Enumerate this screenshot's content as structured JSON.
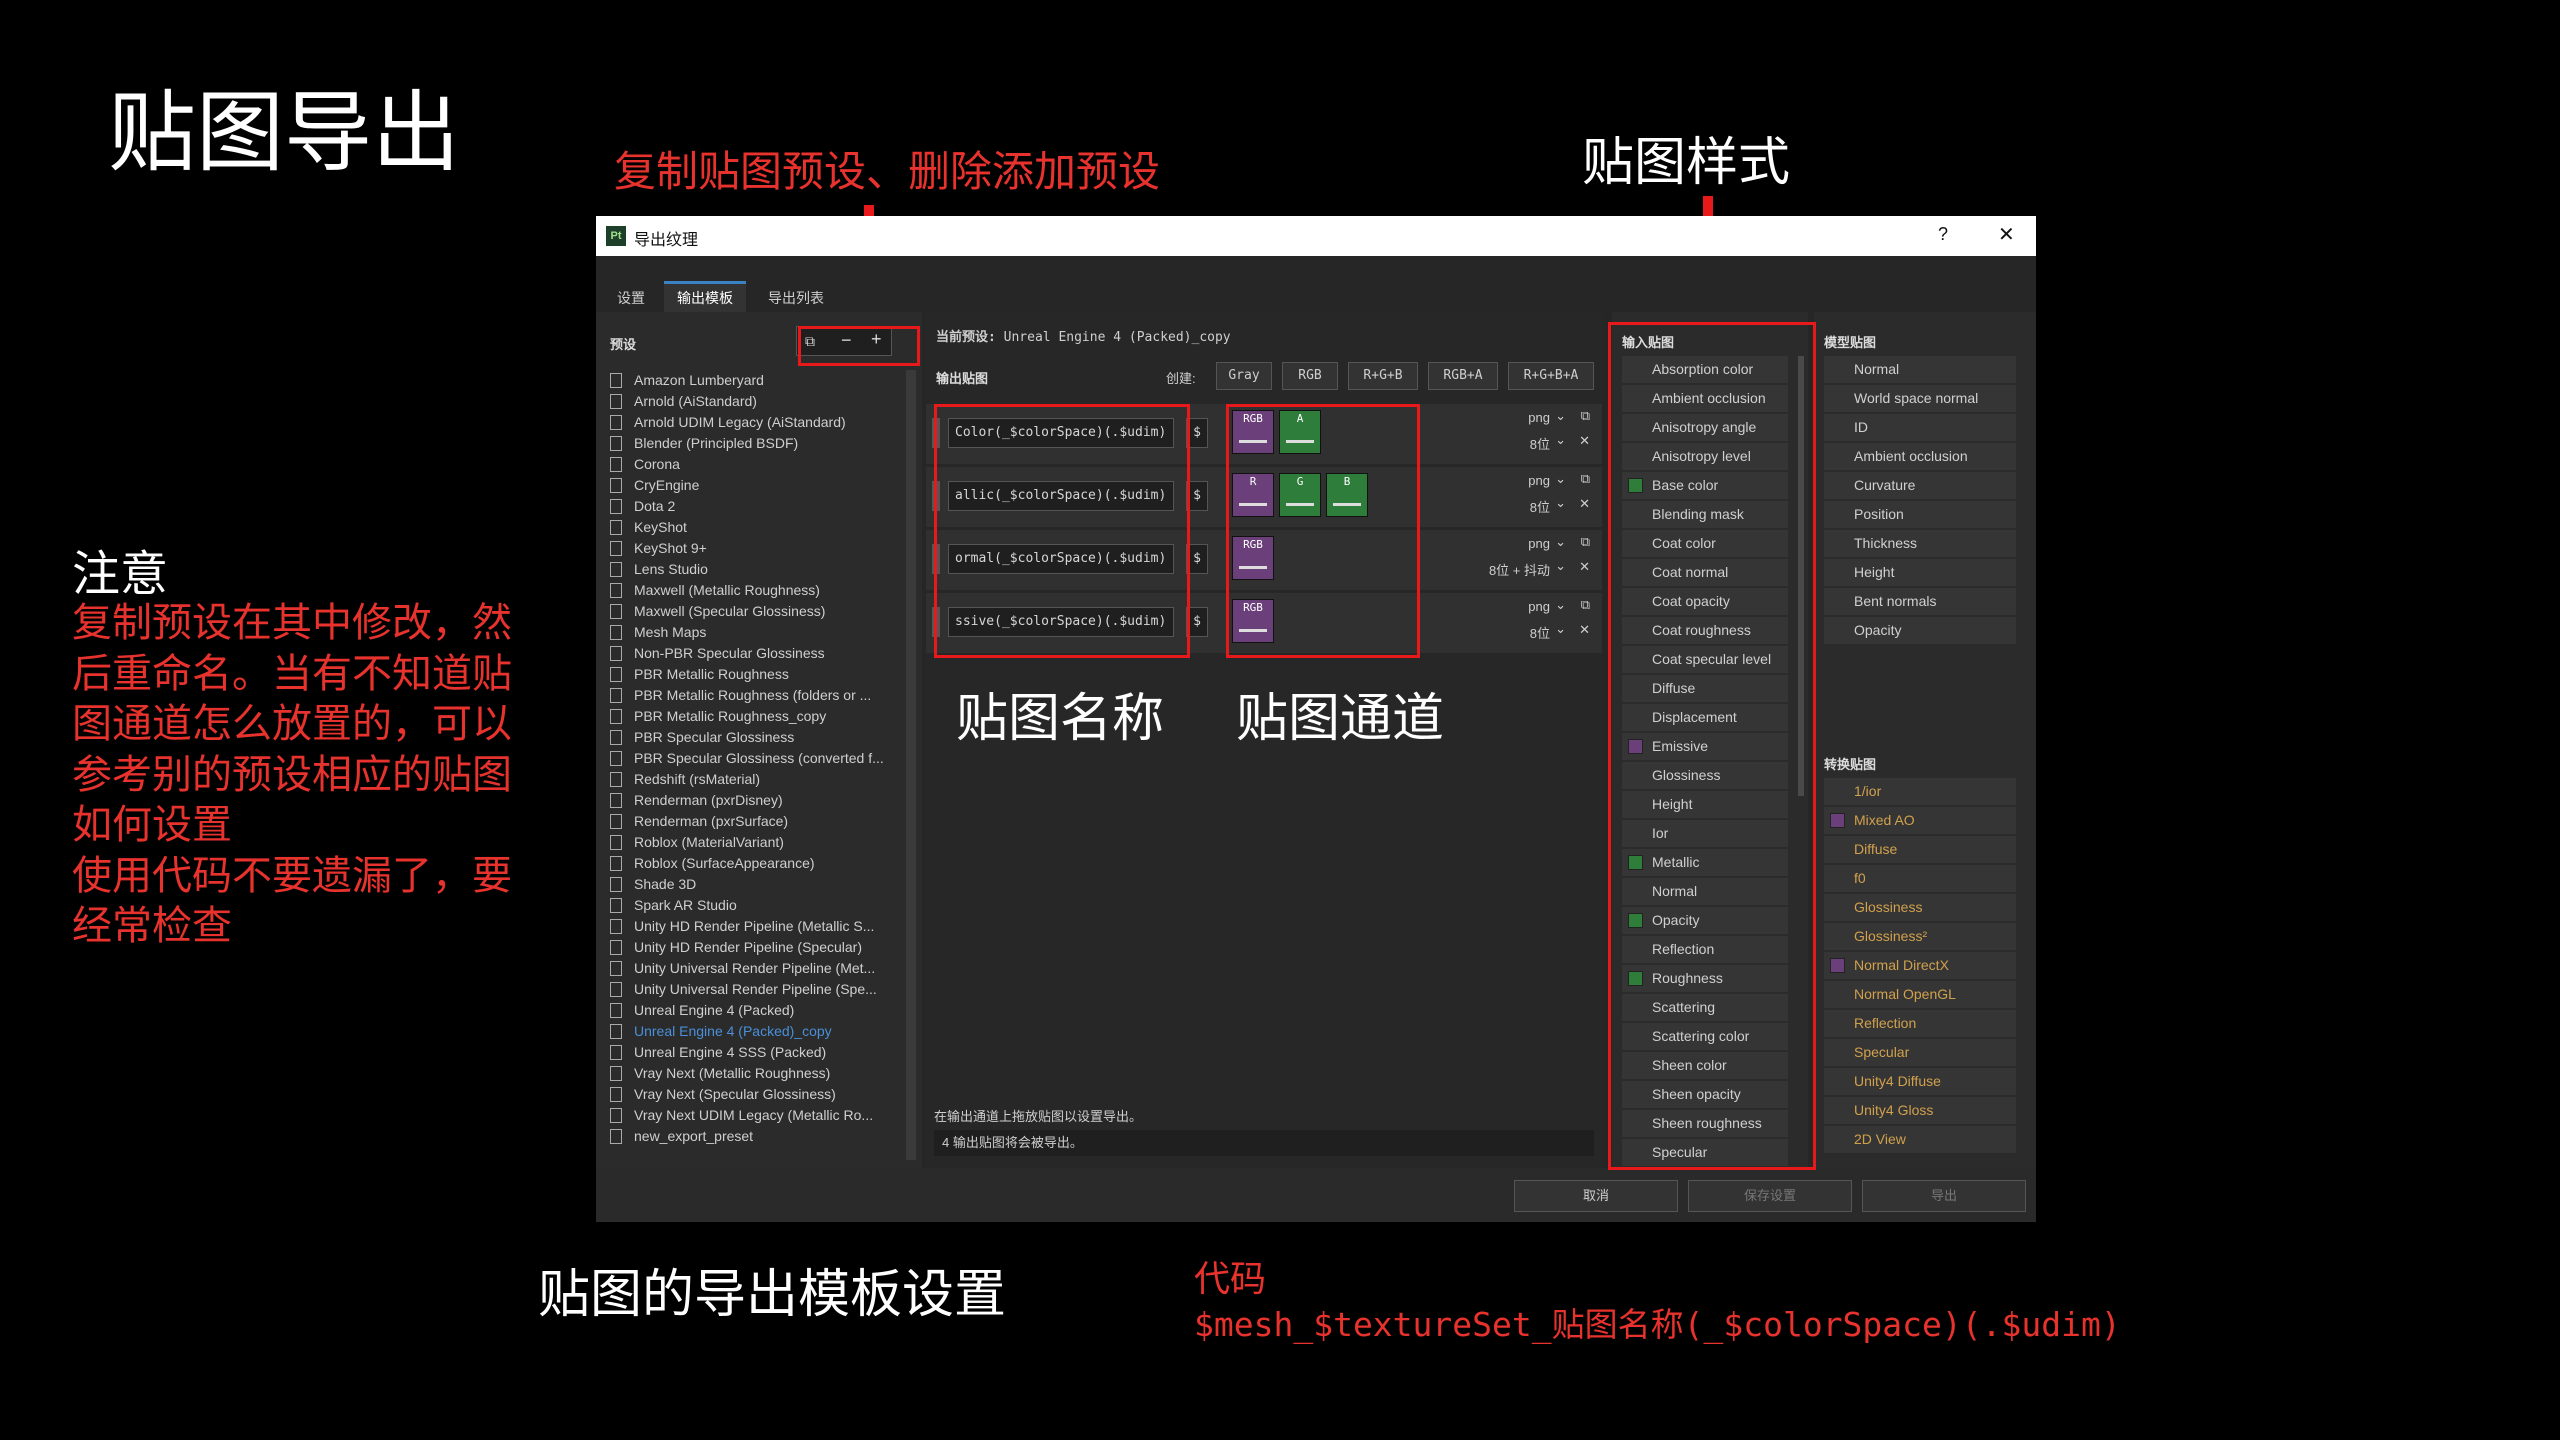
{
  "slide": {
    "title": "贴图导出",
    "note_title": "注意",
    "note_lines": [
      "复制预设在其中修改，然",
      "后重命名。当有不知道贴",
      "图通道怎么放置的，可以",
      "参考别的预设相应的贴图",
      "如何设置",
      "使用代码不要遗漏了，要",
      "经常检查"
    ],
    "annot_copy_preset": "复制贴图预设、删除添加预设",
    "annot_map_style": "贴图样式",
    "annot_map_name": "贴图名称",
    "annot_map_channel": "贴图通道",
    "caption": "贴图的导出模板设置",
    "code_label": "代码",
    "code_value": "$mesh_$textureSet_贴图名称(_$colorSpace)(.$udim)"
  },
  "dialog": {
    "app_icon": "Pt",
    "title": "导出纹理",
    "help": "?",
    "close": "✕",
    "tabs": [
      "设置",
      "输出模板",
      "导出列表"
    ],
    "presets_header": "预设",
    "presets": [
      "Amazon Lumberyard",
      "Arnold (AiStandard)",
      "Arnold UDIM Legacy (AiStandard)",
      "Blender (Principled BSDF)",
      "Corona",
      "CryEngine",
      "Dota 2",
      "KeyShot",
      "KeyShot 9+",
      "Lens Studio",
      "Maxwell (Metallic Roughness)",
      "Maxwell (Specular Glossiness)",
      "Mesh Maps",
      "Non-PBR Specular Glossiness",
      "PBR Metallic Roughness",
      "PBR Metallic Roughness (folders or ...",
      "PBR Metallic Roughness_copy",
      "PBR Specular Glossiness",
      "PBR Specular Glossiness (converted f...",
      "Redshift (rsMaterial)",
      "Renderman (pxrDisney)",
      "Renderman (pxrSurface)",
      "Roblox (MaterialVariant)",
      "Roblox (SurfaceAppearance)",
      "Shade 3D",
      "Spark AR Studio",
      "Unity HD Render Pipeline (Metallic S...",
      "Unity HD Render Pipeline (Specular)",
      "Unity Universal Render Pipeline (Met...",
      "Unity Universal Render Pipeline (Spe...",
      "Unreal Engine 4 (Packed)",
      "Unreal Engine 4 (Packed)_copy",
      "Unreal Engine 4 SSS (Packed)",
      "Vray Next (Metallic Roughness)",
      "Vray Next (Specular Glossiness)",
      "Vray Next UDIM Legacy (Metallic Ro...",
      "new_export_preset"
    ],
    "selected_preset_index": 31,
    "current_preset_label": "当前预设:",
    "current_preset_value": "Unreal Engine 4 (Packed)_copy",
    "output_maps_label": "输出贴图",
    "create_label": "创建:",
    "create_buttons": [
      "Gray",
      "RGB",
      "R+G+B",
      "RGB+A",
      "R+G+B+A"
    ],
    "maps": [
      {
        "name": "Color(_$colorSpace)(.$udim)",
        "dollar": "$",
        "fmt": "png",
        "bits": "8位",
        "extra": ""
      },
      {
        "name": "allic(_$colorSpace)(.$udim)",
        "dollar": "$",
        "fmt": "png",
        "bits": "8位",
        "extra": ""
      },
      {
        "name": "ormal(_$colorSpace)(.$udim)",
        "dollar": "$",
        "fmt": "png",
        "bits": "8位 + 抖动",
        "extra": ""
      },
      {
        "name": "ssive(_$colorSpace)(.$udim)",
        "dollar": "$",
        "fmt": "png",
        "bits": "8位",
        "extra": ""
      }
    ],
    "channels": [
      [
        {
          "label": "RGB",
          "color": "#6b3f7a"
        },
        {
          "label": "A",
          "color": "#2e7d3a"
        }
      ],
      [
        {
          "label": "R",
          "color": "#6b3f7a"
        },
        {
          "label": "G",
          "color": "#2e7d3a"
        },
        {
          "label": "B",
          "color": "#2e7d3a"
        }
      ],
      [
        {
          "label": "RGB",
          "color": "#6b3f7a"
        }
      ],
      [
        {
          "label": "RGB",
          "color": "#6b3f7a"
        }
      ]
    ],
    "hint": "在输出通道上拖放贴图以设置导出。",
    "status": "4 输出贴图将会被导出。",
    "input_maps_header": "输入贴图",
    "input_maps": [
      {
        "label": "Absorption color",
        "swatch": ""
      },
      {
        "label": "Ambient occlusion",
        "swatch": ""
      },
      {
        "label": "Anisotropy angle",
        "swatch": ""
      },
      {
        "label": "Anisotropy level",
        "swatch": ""
      },
      {
        "label": "Base color",
        "swatch": "#2e7d3a"
      },
      {
        "label": "Blending mask",
        "swatch": ""
      },
      {
        "label": "Coat color",
        "swatch": ""
      },
      {
        "label": "Coat normal",
        "swatch": ""
      },
      {
        "label": "Coat opacity",
        "swatch": ""
      },
      {
        "label": "Coat roughness",
        "swatch": ""
      },
      {
        "label": "Coat specular level",
        "swatch": ""
      },
      {
        "label": "Diffuse",
        "swatch": ""
      },
      {
        "label": "Displacement",
        "swatch": ""
      },
      {
        "label": "Emissive",
        "swatch": "#6b3f7a"
      },
      {
        "label": "Glossiness",
        "swatch": ""
      },
      {
        "label": "Height",
        "swatch": ""
      },
      {
        "label": "Ior",
        "swatch": ""
      },
      {
        "label": "Metallic",
        "swatch": "#2e7d3a"
      },
      {
        "label": "Normal",
        "swatch": ""
      },
      {
        "label": "Opacity",
        "swatch": "#2e7d3a"
      },
      {
        "label": "Reflection",
        "swatch": ""
      },
      {
        "label": "Roughness",
        "swatch": "#2e7d3a"
      },
      {
        "label": "Scattering",
        "swatch": ""
      },
      {
        "label": "Scattering color",
        "swatch": ""
      },
      {
        "label": "Sheen color",
        "swatch": ""
      },
      {
        "label": "Sheen opacity",
        "swatch": ""
      },
      {
        "label": "Sheen roughness",
        "swatch": ""
      },
      {
        "label": "Specular",
        "swatch": ""
      }
    ],
    "mesh_maps_header": "模型贴图",
    "mesh_maps": [
      "Normal",
      "World space normal",
      "ID",
      "Ambient occlusion",
      "Curvature",
      "Position",
      "Thickness",
      "Height",
      "Bent normals",
      "Opacity"
    ],
    "converted_header": "转换贴图",
    "converted_maps": [
      {
        "label": "1/ior",
        "swatch": ""
      },
      {
        "label": "Mixed AO",
        "swatch": "#6b3f7a"
      },
      {
        "label": "Diffuse",
        "swatch": ""
      },
      {
        "label": "f0",
        "swatch": ""
      },
      {
        "label": "Glossiness",
        "swatch": ""
      },
      {
        "label": "Glossiness²",
        "swatch": ""
      },
      {
        "label": "Normal DirectX",
        "swatch": "#6b3f7a"
      },
      {
        "label": "Normal OpenGL",
        "swatch": ""
      },
      {
        "label": "Reflection",
        "swatch": ""
      },
      {
        "label": "Specular",
        "swatch": ""
      },
      {
        "label": "Unity4 Diffuse",
        "swatch": ""
      },
      {
        "label": "Unity4 Gloss",
        "swatch": ""
      },
      {
        "label": "2D View",
        "swatch": ""
      }
    ],
    "footer_buttons": [
      "取消",
      "保存设置",
      "导出"
    ]
  }
}
